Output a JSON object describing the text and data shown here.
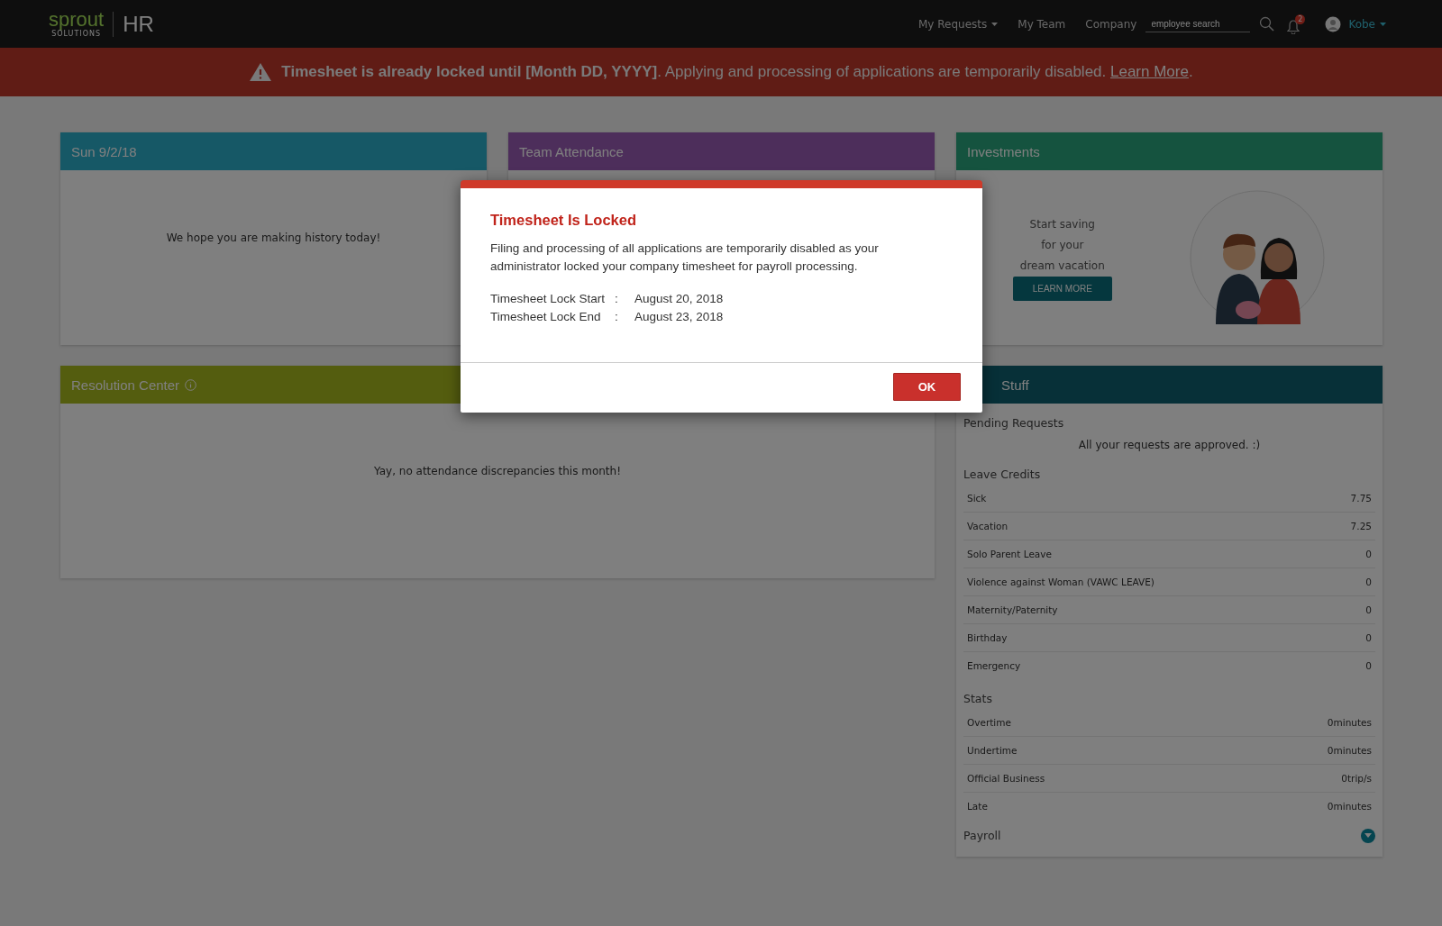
{
  "navbar": {
    "logo": {
      "wordmark": "sprout",
      "tagline": "SOLUTIONS",
      "product": "HR"
    },
    "menu": [
      {
        "label": "My Requests",
        "dropdown": true
      },
      {
        "label": "My Team",
        "dropdown": false
      },
      {
        "label": "Company",
        "dropdown": false
      }
    ],
    "search": {
      "placeholder": "employee search"
    },
    "notifications": {
      "count": "2"
    },
    "user": {
      "name": "Kobe"
    }
  },
  "banner": {
    "message": "**Timesheet is already locked until [Month DD, YYYY]**. Applying and processing of applications are temporarily disabled.",
    "link": "Learn More",
    "suffix": "."
  },
  "cards": [
    {
      "kind": "message",
      "title": "Sun 9/2/18",
      "color": "#165866",
      "text": "We hope you are making history today!"
    },
    {
      "kind": "empty",
      "title": "Team Attendance",
      "color": "#4d2e5b"
    },
    {
      "kind": "promo",
      "title": "Investments",
      "color": "#15533f",
      "lines": [
        "Start saving",
        "for your",
        "dream vacation"
      ],
      "button": "LEARN MORE"
    },
    {
      "kind": "message",
      "title": "Resolution Center",
      "color": "#545d0f",
      "info": true,
      "text": "Yay, no attendance discrepancies this month!"
    }
  ],
  "my_stuff": {
    "title": "Stuff",
    "color": "#073038",
    "pending": {
      "heading": "Pending Requests",
      "text": "All your requests are approved. :)"
    },
    "leave_credits": {
      "heading": "Leave Credits",
      "rows": [
        {
          "label": "Sick",
          "value": "7.75"
        },
        {
          "label": "Vacation",
          "value": "7.25"
        },
        {
          "label": "Solo Parent Leave",
          "value": "0"
        },
        {
          "label": "Violence against Woman (VAWC LEAVE)",
          "value": "0"
        },
        {
          "label": "Maternity/Paternity",
          "value": "0"
        },
        {
          "label": "Birthday",
          "value": "0"
        },
        {
          "label": "Emergency",
          "value": "0"
        }
      ]
    },
    "stats": {
      "heading": "Stats",
      "rows": [
        {
          "label": "Overtime",
          "value": "0minutes"
        },
        {
          "label": "Undertime",
          "value": "0minutes"
        },
        {
          "label": "Official Business",
          "value": "0trip/s"
        },
        {
          "label": "Late",
          "value": "0minutes"
        }
      ]
    },
    "payroll": {
      "heading": "Payroll",
      "expanded": false
    }
  },
  "modal": {
    "title": "Timesheet Is Locked",
    "text": "Filing and processing of all applications are temporarily disabled as your administrator locked your company timesheet for payroll processing.",
    "details": [
      {
        "label": "Timesheet Lock Start",
        "separator": ":",
        "value": "August 20, 2018"
      },
      {
        "label": "Timesheet Lock End",
        "separator": ":",
        "value": "August 23, 2018"
      }
    ],
    "button": "OK"
  }
}
